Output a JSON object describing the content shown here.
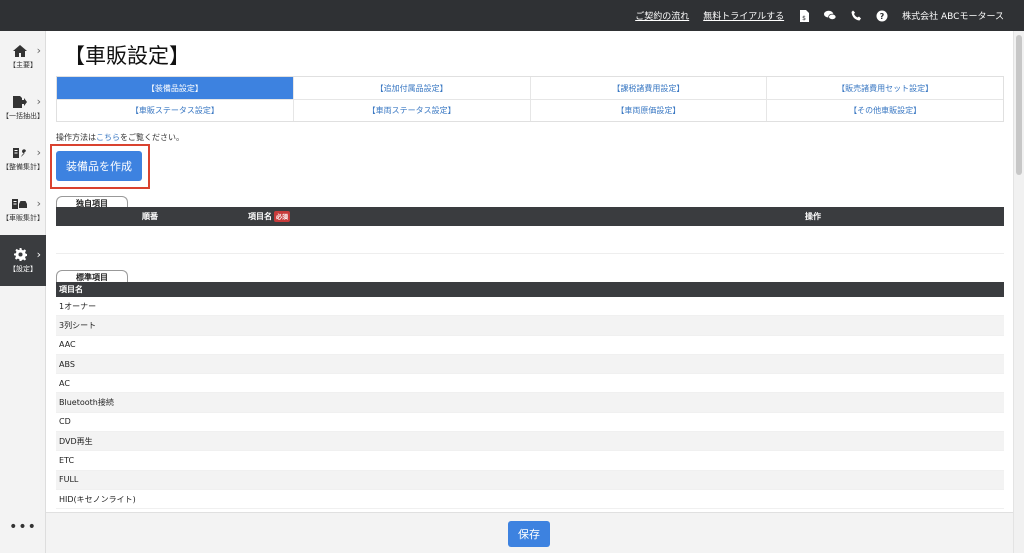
{
  "topbar": {
    "contract_flow": "ご契約の流れ",
    "free_trial": "無料トライアルする",
    "company": "株式会社 ABCモータース"
  },
  "sidebar": {
    "items": [
      {
        "label": "【主要】",
        "icon": "home-icon"
      },
      {
        "label": "【一括抽出】",
        "icon": "file-export-icon"
      },
      {
        "label": "【整備集計】",
        "icon": "wrench-icon"
      },
      {
        "label": "【車販集計】",
        "icon": "car-icon"
      },
      {
        "label": "【設定】",
        "icon": "gear-icon"
      }
    ],
    "more": "•••"
  },
  "page": {
    "title": "【車販設定】",
    "tabs_row1": [
      "【装備品設定】",
      "【追加付属品設定】",
      "【課税諸費用設定】",
      "【販売諸費用セット設定】"
    ],
    "tabs_row2": [
      "【車販ステータス設定】",
      "【車両ステータス設定】",
      "【車両原価設定】",
      "【その他車販設定】"
    ],
    "note_prefix": "操作方法は",
    "note_link": "こちら",
    "note_suffix": "をご覧ください。",
    "create_button": "装備品を作成"
  },
  "custom_section": {
    "tab_label": "独自項目",
    "col_order": "順番",
    "col_name": "項目名",
    "required_badge": "必須",
    "col_action": "操作"
  },
  "standard_section": {
    "tab_label": "標準項目",
    "col_name": "項目名",
    "items": [
      "1オーナー",
      "3列シート",
      "AAC",
      "ABS",
      "AC",
      "Bluetooth接続",
      "CD",
      "DVD再生",
      "ETC",
      "FULL",
      "HID(キセノンライト)"
    ]
  },
  "footer": {
    "save": "保存"
  },
  "colors": {
    "accent": "#3d82e0",
    "header_dark": "#2f3134",
    "highlight": "#d9422f"
  }
}
